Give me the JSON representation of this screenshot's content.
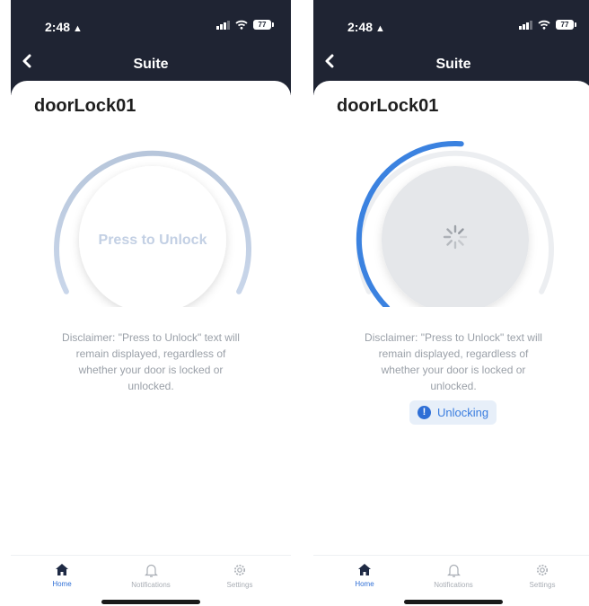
{
  "colors": {
    "header_bg": "#1f2433",
    "accent": "#2f6fd6",
    "dial_idle": "#bfcde1",
    "dial_track": "#eceef1",
    "knob_busy": "#e5e7ea",
    "text_muted": "#9aa0a8"
  },
  "screens": [
    {
      "state": "idle",
      "status_bar": {
        "time": "2:48",
        "battery": "77"
      },
      "nav": {
        "back_icon": "chevron-left-icon",
        "title": "Suite"
      },
      "device_name": "doorLock01",
      "lock_button": {
        "label": "Press to Unlock",
        "progress": 0
      },
      "disclaimer": "Disclaimer: \"Press to Unlock\" text will remain displayed, regardless of whether your door is locked or unlocked.",
      "tabs": [
        {
          "label": "Home",
          "icon": "home-icon",
          "active": true
        },
        {
          "label": "Notifications",
          "icon": "bell-icon",
          "active": false
        },
        {
          "label": "Settings",
          "icon": "gear-icon",
          "active": false
        }
      ]
    },
    {
      "state": "unlocking",
      "status_bar": {
        "time": "2:48",
        "battery": "77"
      },
      "nav": {
        "back_icon": "chevron-left-icon",
        "title": "Suite"
      },
      "device_name": "doorLock01",
      "lock_button": {
        "label": "",
        "progress": 0.55,
        "spinner_icon": "spinner-icon"
      },
      "disclaimer": "Disclaimer: \"Press to Unlock\" text will remain displayed, regardless of whether your door is locked or unlocked.",
      "status_badge": {
        "icon": "info-icon",
        "icon_glyph": "!",
        "text": "Unlocking"
      },
      "tabs": [
        {
          "label": "Home",
          "icon": "home-icon",
          "active": true
        },
        {
          "label": "Notifications",
          "icon": "bell-icon",
          "active": false
        },
        {
          "label": "Settings",
          "icon": "gear-icon",
          "active": false
        }
      ]
    }
  ]
}
